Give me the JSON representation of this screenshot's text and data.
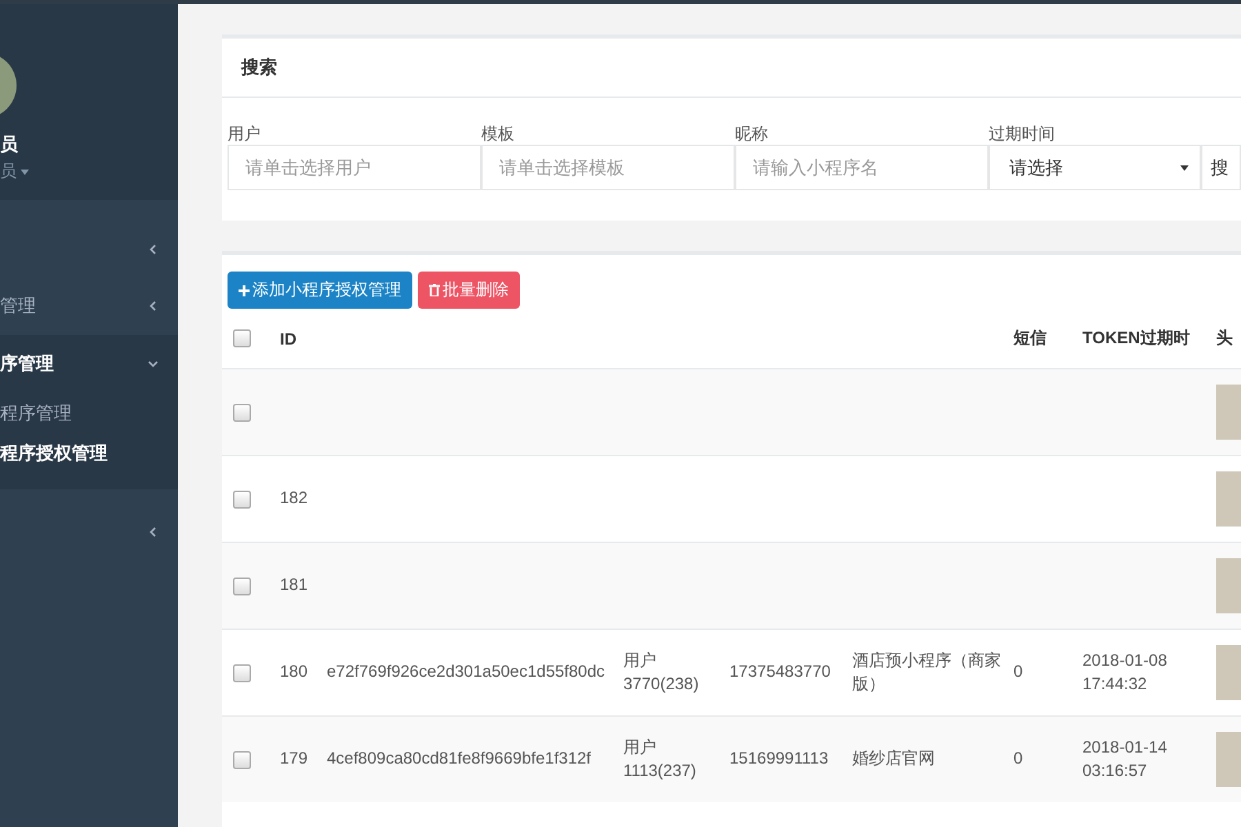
{
  "sidebar": {
    "profile": {
      "name": "员",
      "role": "员"
    },
    "menu": [
      {
        "expanded": false
      },
      {
        "label": "管理",
        "expanded": false
      },
      {
        "label": "序管理",
        "expanded": true,
        "children": [
          {
            "label": "程序管理",
            "selected": false
          },
          {
            "label": "程序授权管理",
            "selected": true
          }
        ]
      },
      {
        "expanded": false
      }
    ]
  },
  "search": {
    "title": "搜索",
    "fields": [
      {
        "kind": "input",
        "label": "用户",
        "placeholder": "请单击选择用户"
      },
      {
        "kind": "input",
        "label": "模板",
        "placeholder": "请单击选择模板"
      },
      {
        "kind": "input",
        "label": "昵称",
        "placeholder": "请输入小程序名"
      },
      {
        "kind": "select",
        "label": "过期时间",
        "value": "请选择"
      }
    ],
    "button": "搜"
  },
  "toolbar": {
    "add": "添加小程序授权管理",
    "delete": "批量删除"
  },
  "table": {
    "header": {
      "checked": false,
      "id": "ID",
      "sms": "短信",
      "token": "TOKEN过期时",
      "avatar": "头"
    },
    "rows": [
      {
        "checked": false
      },
      {
        "checked": false,
        "id": "182"
      },
      {
        "checked": false,
        "id": "181"
      },
      {
        "checked": false,
        "id": "180",
        "appid": "e72f769f926ce2d301a50ec1d55f80dc",
        "user": "用户3770(238)",
        "phone": "17375483770",
        "name": "酒店预小程序（商家版）",
        "sms": "0",
        "expires": "2018-01-08 17:44:32"
      },
      {
        "checked": false,
        "id": "179",
        "appid": "4cef809ca80cd81fe8f9669bfe1f312f",
        "user": "用户1113(237)",
        "phone": "15169991113",
        "name": "婚纱店官网",
        "sms": "0",
        "expires": "2018-01-14 03:16:57"
      }
    ]
  }
}
